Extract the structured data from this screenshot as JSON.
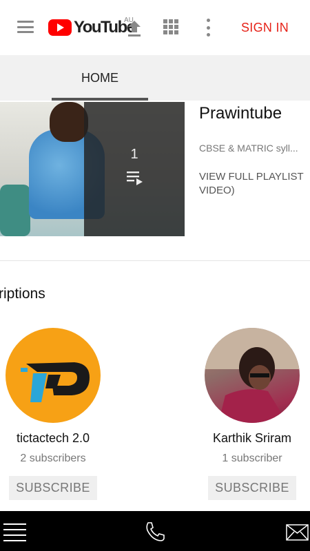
{
  "header": {
    "logo_text": "YouTube",
    "region_label": "AU",
    "menu_icon": "hamburger-icon",
    "upload_icon": "upload-icon",
    "apps_icon": "apps-grid-icon",
    "more_icon": "more-vert-icon",
    "sign_in_label": "SIGN IN",
    "sign_in_color": "#e62117",
    "logo_color": "#ff0000"
  },
  "tabs": [
    {
      "label": "HOME",
      "active": true
    }
  ],
  "featured": {
    "playlist_count": "1",
    "playlist_icon": "playlist-play-icon",
    "title": "Prawintube",
    "subtitle": "CBSE & MATRIC syll...",
    "view_playlist_label_line1": "VIEW FULL PLAYLIST",
    "view_playlist_label_line2": "VIDEO)"
  },
  "subscriptions": {
    "title": "riptions",
    "channels": [
      {
        "name": "tictactech 2.0",
        "subscribers": "2 subscribers",
        "button": "SUBSCRIBE"
      },
      {
        "name": "Karthik Sriram",
        "subscribers": "1 subscriber",
        "button": "SUBSCRIBE"
      }
    ]
  },
  "bottom_bar": {
    "menu_icon": "menu-lines-icon",
    "phone_icon": "phone-icon",
    "mail_icon": "mail-icon"
  }
}
